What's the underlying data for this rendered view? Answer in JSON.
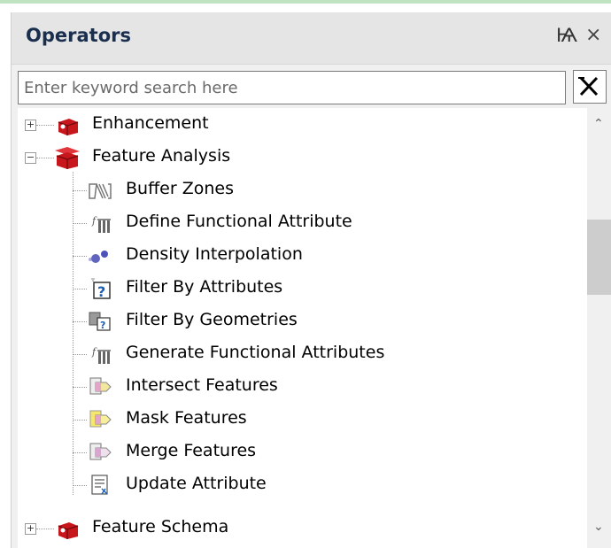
{
  "panel": {
    "title": "Operators",
    "pin_glyph": "Ѩ",
    "close_glyph": "×"
  },
  "search": {
    "placeholder": "Enter keyword search here",
    "value": "",
    "clear_icon": "clear-icon"
  },
  "tree": {
    "groups": [
      {
        "label": "Enhancement",
        "expanded": false,
        "icon": "red-toolbox-icon"
      },
      {
        "label": "Feature Analysis",
        "expanded": true,
        "icon": "red-toolbox-open-icon",
        "items": [
          {
            "label": "Buffer Zones",
            "icon": "buffer-zones-icon"
          },
          {
            "label": "Define Functional Attribute",
            "icon": "functional-attribute-icon"
          },
          {
            "label": "Density Interpolation",
            "icon": "density-icon"
          },
          {
            "label": "Filter By Attributes",
            "icon": "filter-attributes-icon"
          },
          {
            "label": "Filter By Geometries",
            "icon": "filter-geometries-icon"
          },
          {
            "label": "Generate Functional Attributes",
            "icon": "functional-attribute-icon"
          },
          {
            "label": "Intersect Features",
            "icon": "intersect-icon"
          },
          {
            "label": "Mask Features",
            "icon": "mask-icon"
          },
          {
            "label": "Merge Features",
            "icon": "merge-icon"
          },
          {
            "label": "Update Attribute",
            "icon": "update-attribute-icon"
          }
        ]
      },
      {
        "label": "Feature Schema",
        "expanded": false,
        "icon": "red-toolbox-icon"
      }
    ]
  },
  "colors": {
    "title_text": "#1a2f4e",
    "toolbox_red": "#c8161d",
    "scroll_thumb": "#cdcdcd"
  }
}
